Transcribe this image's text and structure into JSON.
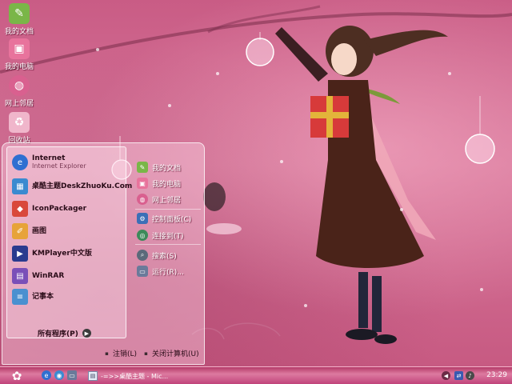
{
  "desktop": {
    "icons": [
      {
        "label": "我的文档",
        "icon": "my-documents-icon",
        "color": "#7ab648"
      },
      {
        "label": "我的电脑",
        "icon": "my-computer-icon",
        "color": "#e8739c"
      },
      {
        "label": "网上邻居",
        "icon": "network-places-icon",
        "color": "#d9608f"
      },
      {
        "label": "回收站",
        "icon": "recycle-bin-icon",
        "color": "#f0b6cb"
      }
    ]
  },
  "start_menu": {
    "programs": [
      {
        "name": "Internet",
        "sub": "Internet Explorer",
        "icon": "internet-explorer-icon",
        "color": "#2f6fd1"
      },
      {
        "name": "桌酷主题DeskZhuoKu.Com",
        "icon": "zhuoku-icon",
        "color": "#3a8ad0"
      },
      {
        "name": "IconPackager",
        "icon": "iconpackager-icon",
        "color": "#d9483b"
      },
      {
        "name": "画图",
        "icon": "paint-icon",
        "color": "#e7a33a"
      },
      {
        "name": "KMPlayer中文版",
        "icon": "kmplayer-icon",
        "color": "#2a3b8f"
      },
      {
        "name": "WinRAR",
        "icon": "winrar-icon",
        "color": "#7a4fb8"
      },
      {
        "name": "记事本",
        "icon": "notepad-icon",
        "color": "#4a90d0"
      }
    ],
    "all_programs": "所有程序(P)",
    "places": [
      {
        "label": "我的文档",
        "icon": "my-documents-icon",
        "color": "#7ab648"
      },
      {
        "label": "我的电脑",
        "icon": "my-computer-icon",
        "color": "#e8739c"
      },
      {
        "label": "网上邻居",
        "icon": "network-places-icon",
        "color": "#d9608f"
      },
      {
        "label": "控制面板(C)",
        "icon": "control-panel-icon",
        "color": "#3b6fb7"
      },
      {
        "label": "连接到(T)",
        "icon": "connect-to-icon",
        "color": "#3c8a5a"
      },
      {
        "label": "搜索(S)",
        "icon": "search-icon",
        "color": "#5a6a7a"
      },
      {
        "label": "运行(R)...",
        "icon": "run-icon",
        "color": "#6a7a9a"
      }
    ],
    "logoff": "注销(L)",
    "shutdown": "关闭计算机(U)"
  },
  "taskbar": {
    "task_label": "-=>>桌酷主题 - Mic...",
    "clock": "23:29"
  }
}
